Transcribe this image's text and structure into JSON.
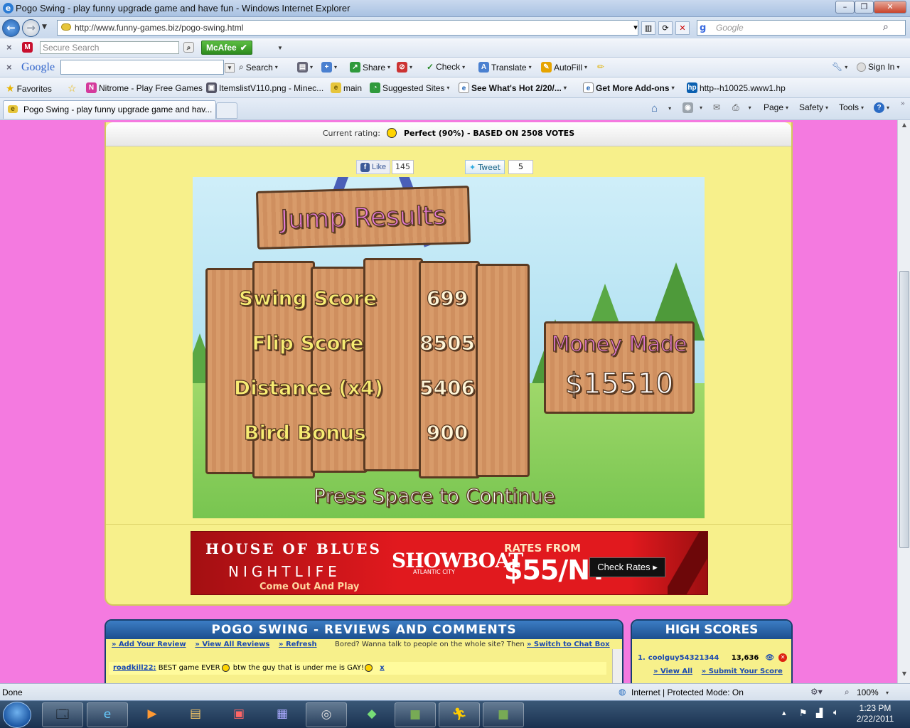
{
  "window": {
    "title": "Pogo Swing - play funny upgrade game and have fun - Windows Internet Explorer",
    "controls": {
      "minimize": "–",
      "maximize": "❐",
      "close": "✕"
    }
  },
  "address_bar": {
    "url": "http://www.funny-games.biz/pogo-swing.html",
    "search_placeholder": "Google"
  },
  "mcafee_toolbar": {
    "search_placeholder": "Secure Search",
    "brand": "McAfee"
  },
  "google_toolbar": {
    "logo": "Google",
    "items": [
      "Search",
      "Share",
      "Check",
      "Translate",
      "AutoFill",
      "Sign In"
    ]
  },
  "favorites_bar": {
    "favorites_label": "Favorites",
    "items": [
      "Nitrome - Play Free Games",
      "ItemslistV110.png - Minec...",
      "main",
      "Suggested Sites",
      "See What's Hot 2/20/...",
      "Get More Add-ons",
      "http--h10025.www1.hp"
    ]
  },
  "tab_bar": {
    "active_tab": "Pogo Swing - play funny upgrade game and hav...",
    "commands": [
      "Page",
      "Safety",
      "Tools"
    ]
  },
  "page": {
    "rating_label": "Current rating:",
    "rating_value": "Perfect (90%)",
    "rating_votes": " - BASED ON 2508 VOTES",
    "like_label": "Like",
    "like_count": "145",
    "tweet_label": "Tweet",
    "tweet_count": "5",
    "game": {
      "title": "Jump Results",
      "scores": [
        {
          "label": "Swing Score",
          "value": "699"
        },
        {
          "label": "Flip Score",
          "value": "8505"
        },
        {
          "label": "Distance (x4)",
          "value": "5406"
        },
        {
          "label": "Bird Bonus",
          "value": "900"
        }
      ],
      "money_label": "Money Made",
      "money_value": "$15510",
      "continue_text": "Press Space to Continue"
    },
    "ad": {
      "brand": "HOUSE OF BLUES",
      "subtitle": "NIGHTLIFE",
      "tagline": "Come Out And Play",
      "casino": "SHOWBOAT",
      "casino_sub": "ATLANTIC CITY",
      "rates_label": "RATES FROM",
      "price": "$55/NT",
      "cta": "Check Rates ▸"
    },
    "reviews": {
      "header": "POGO SWING - REVIEWS AND COMMENTS",
      "add_review": "» Add Your Review",
      "view_all": "» View All Reviews",
      "refresh": "» Refresh",
      "chat_text": "Bored? Wanna talk to people on the whole site? Then",
      "chat_link": "» Switch to Chat Box",
      "comment_user": "roadkill22:",
      "comment_text": "BEST game EVER",
      "comment_tail": "btw the guy that is under me is GAY!"
    },
    "high_scores": {
      "header": "HIGH SCORES",
      "top_entry": {
        "rank": "1.",
        "user": "coolguy54321344",
        "score": "13,636"
      },
      "view_all": "» View All",
      "submit": "» Submit Your Score"
    }
  },
  "status_bar": {
    "status": "Done",
    "zone": "Internet | Protected Mode: On",
    "zoom": "100%"
  },
  "taskbar": {
    "time": "1:23 PM",
    "date": "2/22/2011"
  }
}
